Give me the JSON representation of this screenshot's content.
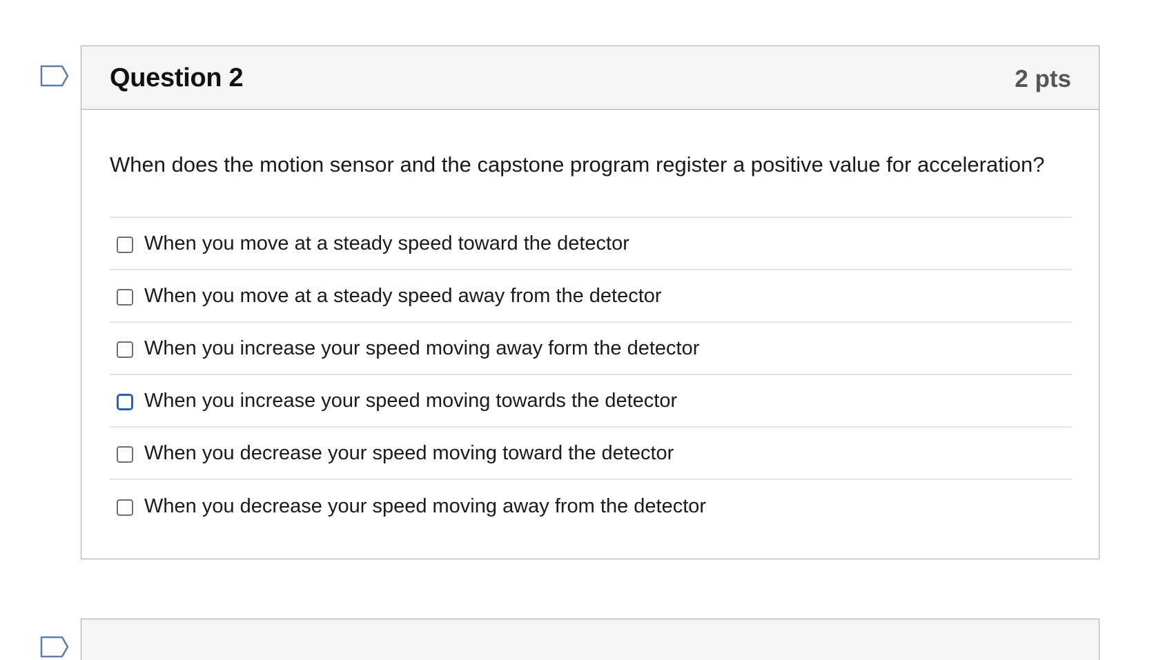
{
  "question": {
    "title": "Question 2",
    "points": "2 pts",
    "text": "When does the motion sensor and the capstone program register a positive value for acceleration?",
    "flag_icon": "flag-outline-icon",
    "answers": [
      {
        "label": "When you move at a steady speed toward the detector",
        "checked": false,
        "focused": false
      },
      {
        "label": "When you move at a steady speed away from the detector",
        "checked": false,
        "focused": false
      },
      {
        "label": "When you increase your speed moving away form the detector",
        "checked": false,
        "focused": false
      },
      {
        "label": "When you increase your speed moving towards the detector",
        "checked": false,
        "focused": true
      },
      {
        "label": "When you decrease your speed moving toward the detector",
        "checked": false,
        "focused": false
      },
      {
        "label": "When you decrease your speed moving away from the detector",
        "checked": false,
        "focused": false
      }
    ]
  },
  "colors": {
    "header_bg": "#f5f5f5",
    "border": "#a8a8a8",
    "flag_stroke": "#5b7fa6",
    "focus_ring": "#2b5fb8",
    "points_text": "#555555"
  }
}
